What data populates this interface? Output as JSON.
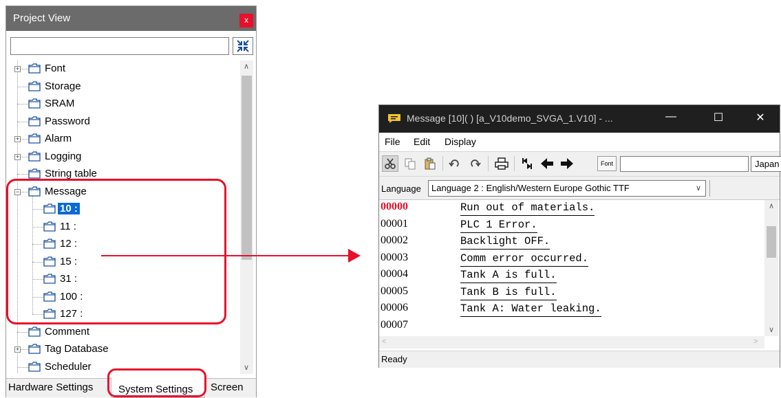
{
  "project_view": {
    "title": "Project View",
    "close_label": "x",
    "search_value": "",
    "tree": [
      {
        "label": "Font",
        "level": 0,
        "expandable": true
      },
      {
        "label": "Storage",
        "level": 0,
        "expandable": false
      },
      {
        "label": "SRAM",
        "level": 0,
        "expandable": false
      },
      {
        "label": "Password",
        "level": 0,
        "expandable": false
      },
      {
        "label": "Alarm",
        "level": 0,
        "expandable": true
      },
      {
        "label": "Logging",
        "level": 0,
        "expandable": true
      },
      {
        "label": "String table",
        "level": 0,
        "expandable": false
      },
      {
        "label": "Message",
        "level": 0,
        "expandable": true,
        "expanded": true
      },
      {
        "label": "10 :",
        "level": 1,
        "selected": true
      },
      {
        "label": "11 :",
        "level": 1
      },
      {
        "label": "12 :",
        "level": 1
      },
      {
        "label": "15 :",
        "level": 1
      },
      {
        "label": "31 :",
        "level": 1
      },
      {
        "label": "100 :",
        "level": 1
      },
      {
        "label": "127 :",
        "level": 1
      },
      {
        "label": "Comment",
        "level": 0,
        "expandable": false
      },
      {
        "label": "Tag Database",
        "level": 0,
        "expandable": true
      },
      {
        "label": "Scheduler",
        "level": 0,
        "expandable": false
      }
    ],
    "tabs": {
      "hardware": "Hardware Settings",
      "system": "System Settings",
      "screen": "Screen"
    }
  },
  "message_window": {
    "title": "Message [10](            ) [a_V10demo_SVGA_1.V10] - ...",
    "menu": [
      "File",
      "Edit",
      "Display"
    ],
    "toolbar": {
      "font_button": "Font",
      "text_value": "",
      "language_button": "Japan"
    },
    "language_label": "Language",
    "language_selected": "Language 2 : English/Western Europe Gothic TTF",
    "rows": [
      {
        "no": "00000",
        "text": "Run out of materials.",
        "current": true
      },
      {
        "no": "00001",
        "text": "PLC 1 Error."
      },
      {
        "no": "00002",
        "text": "Backlight OFF."
      },
      {
        "no": "00003",
        "text": "Comm error occurred."
      },
      {
        "no": "00004",
        "text": "Tank A is full."
      },
      {
        "no": "00005",
        "text": "Tank B is full."
      },
      {
        "no": "00006",
        "text": "Tank A: Water leaking."
      },
      {
        "no": "00007",
        "text": ""
      }
    ],
    "status": "Ready"
  },
  "colors": {
    "highlight_red": "#e8102a",
    "selection_blue": "#0a6ad6",
    "title_bar_dark": "#1f1f1f",
    "panel_title_gray": "#6b6b6b"
  }
}
